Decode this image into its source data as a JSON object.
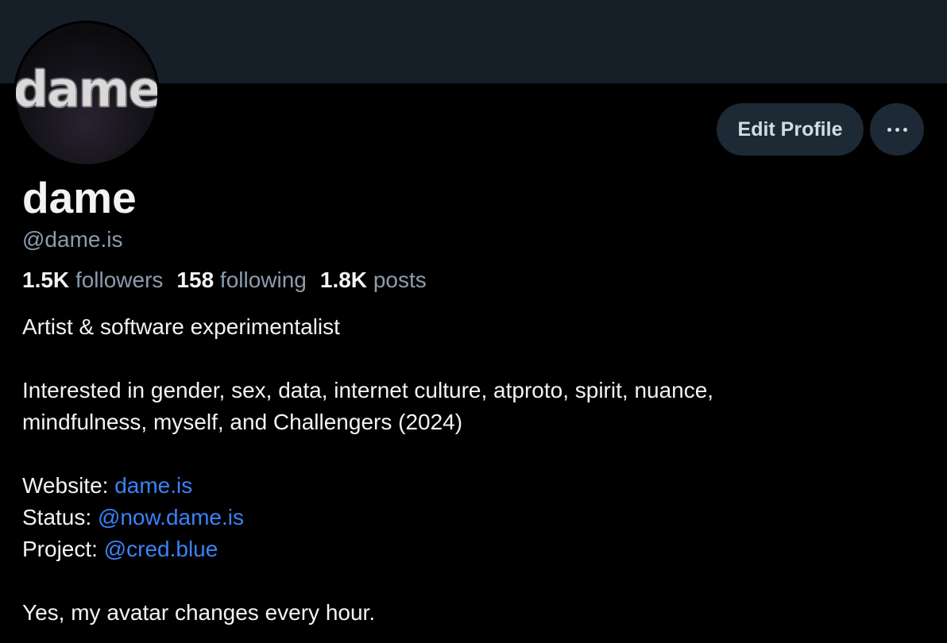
{
  "profile": {
    "avatar_text": "dame",
    "display_name": "dame",
    "handle": "@dame.is",
    "edit_button_label": "Edit Profile",
    "more_button_icon": "ellipsis-icon"
  },
  "stats": {
    "followers_count": "1.5K",
    "followers_label": "followers",
    "following_count": "158",
    "following_label": "following",
    "posts_count": "1.8K",
    "posts_label": "posts"
  },
  "bio": {
    "line1": "Artist & software experimentalist",
    "line2": "Interested in gender, sex, data, internet culture, atproto, spirit, nuance,",
    "line3": "mindfulness, myself, and Challengers (2024)",
    "website_label": "Website: ",
    "website_link": "dame.is",
    "status_label": "Status: ",
    "status_link": "@now.dame.is",
    "project_label": "Project: ",
    "project_link": "@cred.blue",
    "last_line": "Yes, my avatar changes every hour."
  },
  "colors": {
    "background": "#000000",
    "banner": "#161e27",
    "button": "#1e2936",
    "muted_text": "#8d9cac",
    "link": "#3b82f6"
  }
}
